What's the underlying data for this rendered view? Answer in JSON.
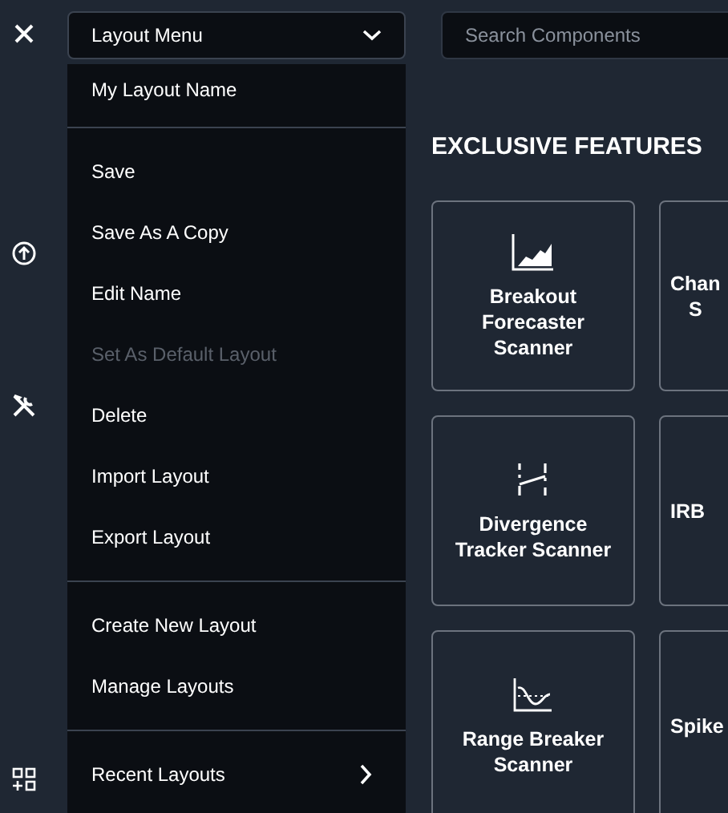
{
  "top_bar": {
    "layout_dropdown": {
      "label": "Layout Menu"
    },
    "search": {
      "placeholder": "Search Components"
    }
  },
  "sidebar_icons": [
    {
      "kind": "close"
    },
    {
      "kind": "upload"
    },
    {
      "kind": "tools"
    },
    {
      "kind": "grid-add"
    }
  ],
  "layout_menu": {
    "sections": [
      {
        "items": [
          {
            "label": "My Layout Name",
            "disabled": false
          }
        ]
      },
      {
        "items": [
          {
            "label": "Save",
            "disabled": false
          },
          {
            "label": "Save As A Copy",
            "disabled": false
          },
          {
            "label": "Edit Name",
            "disabled": false
          },
          {
            "label": "Set As Default Layout",
            "disabled": true
          },
          {
            "label": "Delete",
            "disabled": false
          },
          {
            "label": "Import Layout",
            "disabled": false
          },
          {
            "label": "Export Layout",
            "disabled": false
          }
        ]
      },
      {
        "items": [
          {
            "label": "Create New Layout",
            "disabled": false
          },
          {
            "label": "Manage Layouts",
            "disabled": false
          }
        ]
      },
      {
        "items": [
          {
            "label": "Recent Layouts",
            "disabled": false,
            "submenu": true
          }
        ]
      }
    ]
  },
  "section_title": "EXCLUSIVE FEATURES",
  "cards": [
    {
      "title": "Breakout Forecaster Scanner",
      "kind": "area-chart"
    },
    {
      "title": "Chan\nS",
      "kind": "clipped"
    },
    {
      "title": "Divergence Tracker Scanner",
      "kind": "divergence"
    },
    {
      "title": "IRB",
      "kind": "clipped"
    },
    {
      "title": "Range Breaker Scanner",
      "kind": "wave"
    },
    {
      "title": "Spike",
      "kind": "clipped"
    }
  ]
}
